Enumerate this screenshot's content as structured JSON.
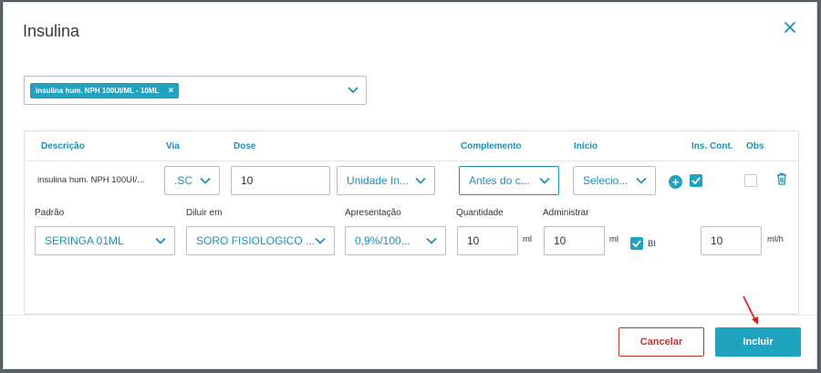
{
  "modal": {
    "title": "Insulina",
    "close_icon": "close-icon"
  },
  "multiselect": {
    "chip_label": "insulina hum. NPH 100UI/ML - 10ML",
    "chip_remove": "×"
  },
  "table": {
    "headers": {
      "descricao": "Descrição",
      "via": "Via",
      "dose": "Dose",
      "complemento": "Complemento",
      "inicio": "Início",
      "ins_cont": "Ins. Cont.",
      "obs": "Obs"
    },
    "row": {
      "descricao": "insulina hum. NPH 100UI/...",
      "via": ".SC",
      "dose": "10",
      "unidade": "Unidade In...",
      "complemento": "Antes do c...",
      "inicio": "Selecio...",
      "ins_cont_checked": true,
      "obs_checked": false
    },
    "detail_labels": {
      "padrao": "Padrão",
      "diluir_em": "Diluir em",
      "apresentacao": "Apresentação",
      "quantidade": "Quantidade",
      "administrar": "Administrar"
    },
    "detail_values": {
      "padrao": "SERINGA 01ML",
      "diluir_em": "SORO FISIOLOGICO ...",
      "apresentacao": "0,9%/100...",
      "quantidade": "10",
      "quantidade_unit": "ml",
      "administrar": "10",
      "administrar_unit": "ml",
      "bi_label": "BI",
      "bi_checked": true,
      "taxa": "10",
      "taxa_unit": "ml/h"
    }
  },
  "footer": {
    "cancel_label": "Cancelar",
    "include_label": "Incluir"
  },
  "colors": {
    "accent": "#1fa3bf",
    "header_text": "#1f8fb1",
    "danger": "#c9302c",
    "annotation_arrow": "#e02020"
  }
}
